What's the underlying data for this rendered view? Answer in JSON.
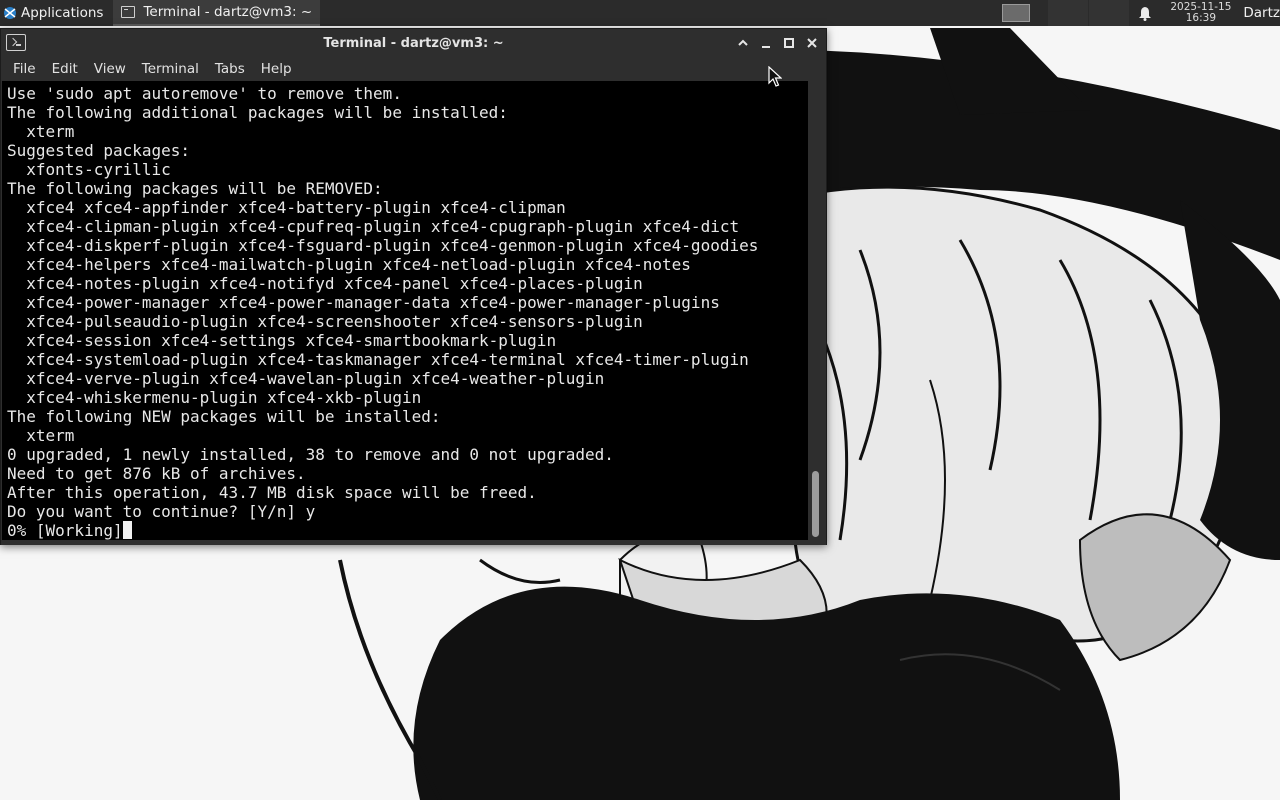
{
  "panel": {
    "applications_label": "Applications",
    "task_label": "Terminal - dartz@vm3: ~",
    "clock_date": "2025-11-15",
    "clock_time": "16:39",
    "user_label": "Dartz",
    "icons": [
      "applications-icon",
      "terminal-task-icon",
      "workspace-icon",
      "bell-icon"
    ]
  },
  "window": {
    "title": "Terminal - dartz@vm3: ~",
    "menu": [
      "File",
      "Edit",
      "View",
      "Terminal",
      "Tabs",
      "Help"
    ],
    "buttons": [
      "shade-up-icon",
      "minimize-icon",
      "maximize-icon",
      "close-icon"
    ]
  },
  "terminal": {
    "lines": [
      "Use 'sudo apt autoremove' to remove them.",
      "The following additional packages will be installed:",
      "  xterm",
      "Suggested packages:",
      "  xfonts-cyrillic",
      "The following packages will be REMOVED:",
      "  xfce4 xfce4-appfinder xfce4-battery-plugin xfce4-clipman",
      "  xfce4-clipman-plugin xfce4-cpufreq-plugin xfce4-cpugraph-plugin xfce4-dict",
      "  xfce4-diskperf-plugin xfce4-fsguard-plugin xfce4-genmon-plugin xfce4-goodies",
      "  xfce4-helpers xfce4-mailwatch-plugin xfce4-netload-plugin xfce4-notes",
      "  xfce4-notes-plugin xfce4-notifyd xfce4-panel xfce4-places-plugin",
      "  xfce4-power-manager xfce4-power-manager-data xfce4-power-manager-plugins",
      "  xfce4-pulseaudio-plugin xfce4-screenshooter xfce4-sensors-plugin",
      "  xfce4-session xfce4-settings xfce4-smartbookmark-plugin",
      "  xfce4-systemload-plugin xfce4-taskmanager xfce4-terminal xfce4-timer-plugin",
      "  xfce4-verve-plugin xfce4-wavelan-plugin xfce4-weather-plugin",
      "  xfce4-whiskermenu-plugin xfce4-xkb-plugin",
      "The following NEW packages will be installed:",
      "  xterm",
      "0 upgraded, 1 newly installed, 38 to remove and 0 not upgraded.",
      "Need to get 876 kB of archives.",
      "After this operation, 43.7 MB disk space will be freed.",
      "Do you want to continue? [Y/n] y"
    ],
    "prompt_line": "0% [Working]"
  },
  "colors": {
    "panel_bg": "#2b2b2b",
    "window_bg": "#2e2e2e",
    "terminal_bg": "#000000",
    "terminal_fg": "#e8e8e8"
  }
}
